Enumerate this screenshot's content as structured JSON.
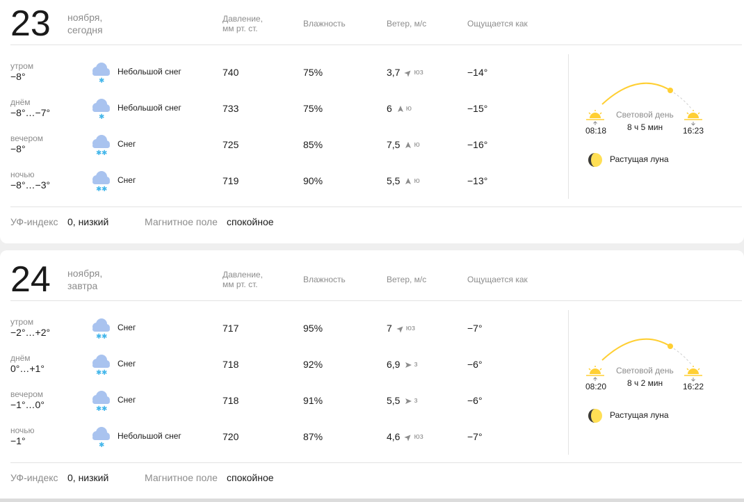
{
  "columns": {
    "pressure": "Давление,",
    "pressure_unit": "мм рт. ст.",
    "humidity": "Влажность",
    "wind": "Ветер, м/с",
    "feels_like": "Ощущается как"
  },
  "days": [
    {
      "day_number": "23",
      "month": "ноября,",
      "relative": "сегодня",
      "parts": [
        {
          "part": "утром",
          "temp": "−8°",
          "icon": "light-snow-icon",
          "condition": "Небольшой снег",
          "pressure": "740",
          "humidity": "75%",
          "wind_speed": "3,7",
          "wind_icon": "arrow-southwest-icon",
          "wind_dir": "юз",
          "feels": "−14°"
        },
        {
          "part": "днём",
          "temp": "−8°…−7°",
          "icon": "light-snow-icon",
          "condition": "Небольшой снег",
          "pressure": "733",
          "humidity": "75%",
          "wind_speed": "6",
          "wind_icon": "arrow-south-icon",
          "wind_dir": "ю",
          "feels": "−15°"
        },
        {
          "part": "вечером",
          "temp": "−8°",
          "icon": "snow-icon",
          "condition": "Снег",
          "pressure": "725",
          "humidity": "85%",
          "wind_speed": "7,5",
          "wind_icon": "arrow-south-icon",
          "wind_dir": "ю",
          "feels": "−16°"
        },
        {
          "part": "ночью",
          "temp": "−8°…−3°",
          "icon": "snow-icon",
          "condition": "Снег",
          "pressure": "719",
          "humidity": "90%",
          "wind_speed": "5,5",
          "wind_icon": "arrow-south-icon",
          "wind_dir": "ю",
          "feels": "−13°"
        }
      ],
      "uv_label": "УФ-индекс",
      "uv_value": "0, низкий",
      "magnetic_label": "Магнитное поле",
      "magnetic_value": "спокойное",
      "sunrise": "08:18",
      "sunset": "16:23",
      "daylight_label": "Световой день",
      "daylight": "8 ч 5 мин",
      "moon": "Растущая луна"
    },
    {
      "day_number": "24",
      "month": "ноября,",
      "relative": "завтра",
      "parts": [
        {
          "part": "утром",
          "temp": "−2°…+2°",
          "icon": "snow-icon",
          "condition": "Снег",
          "pressure": "717",
          "humidity": "95%",
          "wind_speed": "7",
          "wind_icon": "arrow-southwest-icon",
          "wind_dir": "юз",
          "feels": "−7°"
        },
        {
          "part": "днём",
          "temp": "0°…+1°",
          "icon": "snow-icon",
          "condition": "Снег",
          "pressure": "718",
          "humidity": "92%",
          "wind_speed": "6,9",
          "wind_icon": "arrow-west-icon",
          "wind_dir": "з",
          "feels": "−6°"
        },
        {
          "part": "вечером",
          "temp": "−1°…0°",
          "icon": "snow-icon",
          "condition": "Снег",
          "pressure": "718",
          "humidity": "91%",
          "wind_speed": "5,5",
          "wind_icon": "arrow-west-icon",
          "wind_dir": "з",
          "feels": "−6°"
        },
        {
          "part": "ночью",
          "temp": "−1°",
          "icon": "light-snow-icon",
          "condition": "Небольшой снег",
          "pressure": "720",
          "humidity": "87%",
          "wind_speed": "4,6",
          "wind_icon": "arrow-southwest-icon",
          "wind_dir": "юз",
          "feels": "−7°"
        }
      ],
      "uv_label": "УФ-индекс",
      "uv_value": "0, низкий",
      "magnetic_label": "Магнитное поле",
      "magnetic_value": "спокойное",
      "sunrise": "08:20",
      "sunset": "16:22",
      "daylight_label": "Световой день",
      "daylight": "8 ч 2 мин",
      "moon": "Растущая луна"
    }
  ],
  "colors": {
    "cloud": "#a9c3ef",
    "snowflake": "#43b6ea",
    "sun": "#ffcf33",
    "label_gray": "#8c8c8c"
  }
}
